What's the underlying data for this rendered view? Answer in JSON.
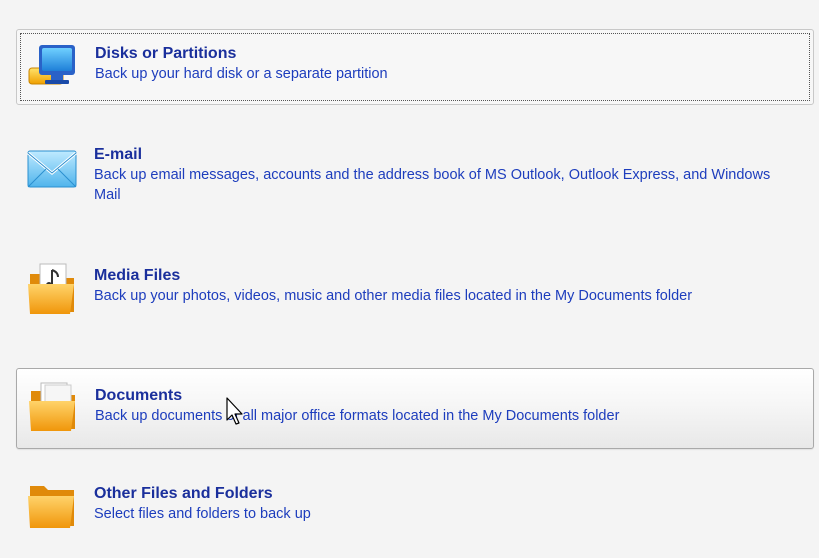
{
  "options": [
    {
      "title": "Disks or Partitions",
      "description": "Back up your hard disk or a separate partition",
      "icon": "monitor-icon",
      "state": "selected"
    },
    {
      "title": "E-mail",
      "description": "Back up email messages, accounts and the address book of MS Outlook, Outlook Express, and Windows Mail",
      "icon": "envelope-icon",
      "state": "normal"
    },
    {
      "title": "Media Files",
      "description": "Back up your photos, videos, music and other media files located in the My Documents folder",
      "icon": "media-folder-icon",
      "state": "normal"
    },
    {
      "title": "Documents",
      "description": "Back up documents of all major office formats located in the My Documents folder",
      "icon": "documents-folder-icon",
      "state": "hover"
    },
    {
      "title": "Other Files and Folders",
      "description": "Select files and folders to back up",
      "icon": "folder-icon",
      "state": "normal"
    }
  ],
  "colors": {
    "title": "#1a2f9c",
    "description": "#1d3dbd",
    "background": "#f4f4f4",
    "folder": "#f5a623"
  }
}
